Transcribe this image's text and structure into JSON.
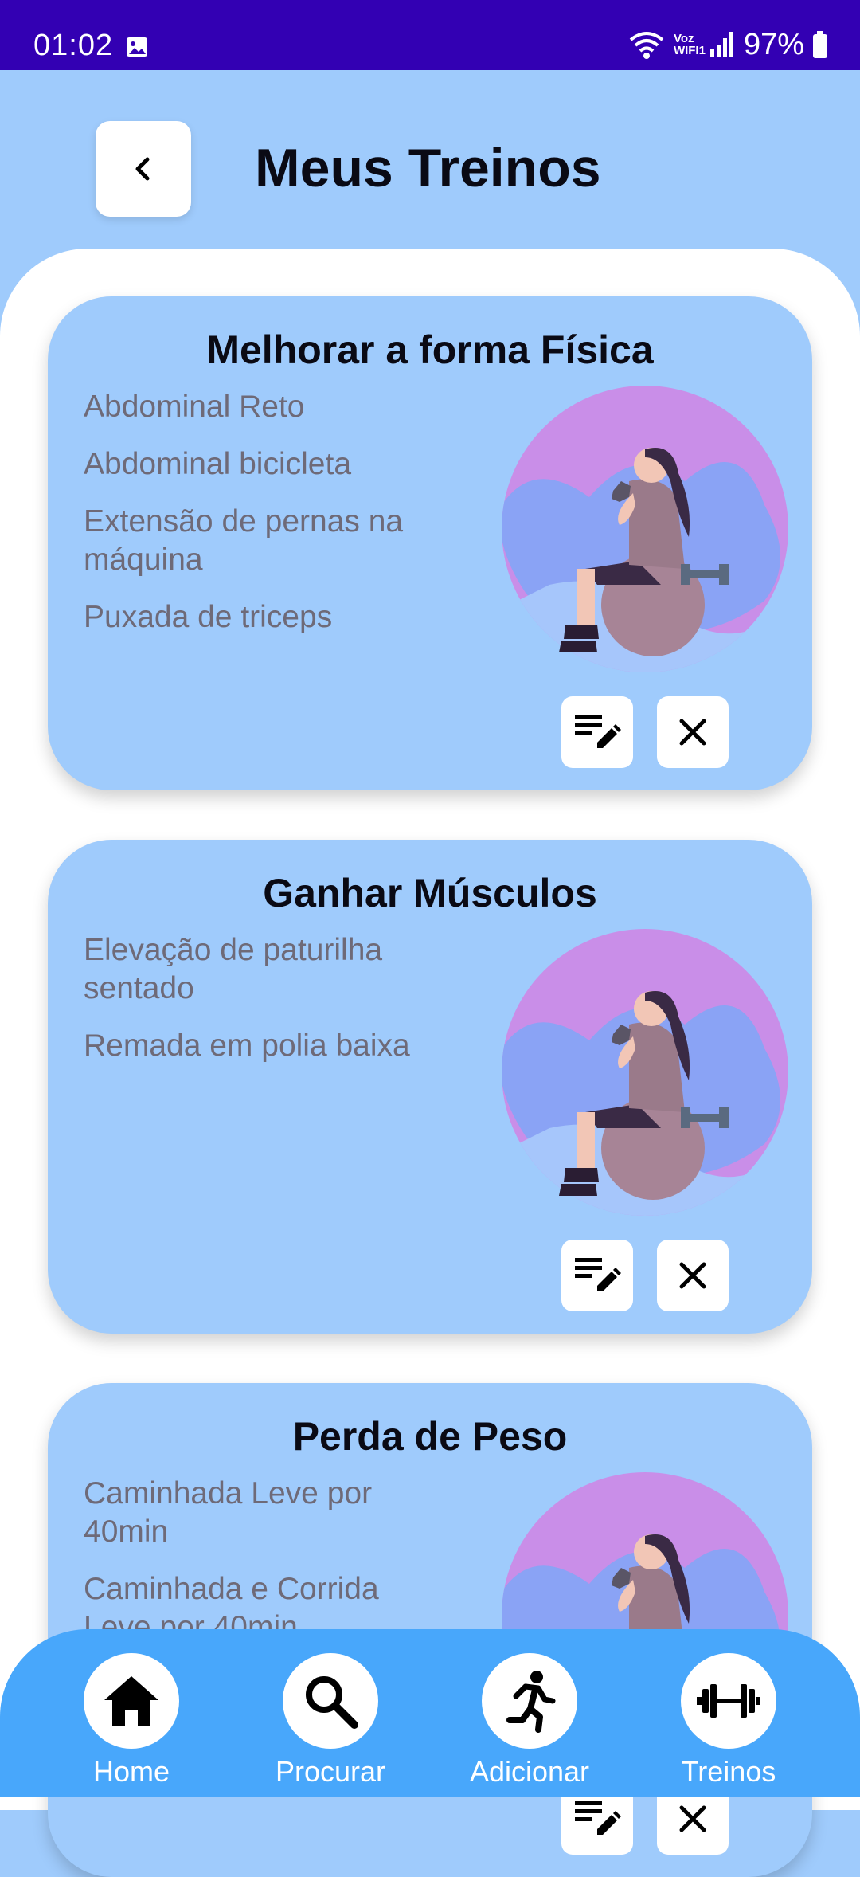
{
  "status_bar": {
    "time": "01:02",
    "network_label": "Voz WIFI1",
    "battery": "97%"
  },
  "header": {
    "title": "Meus Treinos",
    "back_icon": "chevron-left-icon"
  },
  "workouts": [
    {
      "title": "Melhorar a forma Física",
      "exercises": [
        "Abdominal Reto",
        "Abdominal bicicleta",
        "Extensão de pernas na máquina",
        "Puxada de triceps"
      ]
    },
    {
      "title": "Ganhar Músculos",
      "exercises": [
        "Elevação de paturilha sentado",
        "Remada em polia baixa"
      ]
    },
    {
      "title": "Perda de Peso",
      "exercises": [
        "Caminhada Leve por 40min",
        "Caminhada e Corrida Leve por 40min"
      ]
    }
  ],
  "nav": {
    "items": [
      {
        "label": "Home",
        "icon": "home-icon"
      },
      {
        "label": "Procurar",
        "icon": "search-icon"
      },
      {
        "label": "Adicionar",
        "icon": "running-person-icon"
      },
      {
        "label": "Treinos",
        "icon": "dumbbell-icon"
      }
    ]
  },
  "colors": {
    "status_bar": "#3300b3",
    "background": "#9fcbfc",
    "card": "#9fcbfc",
    "nav": "#48a7fb",
    "illustration_circle": "#c98ee8",
    "illustration_blob": "#8aa3f5"
  }
}
